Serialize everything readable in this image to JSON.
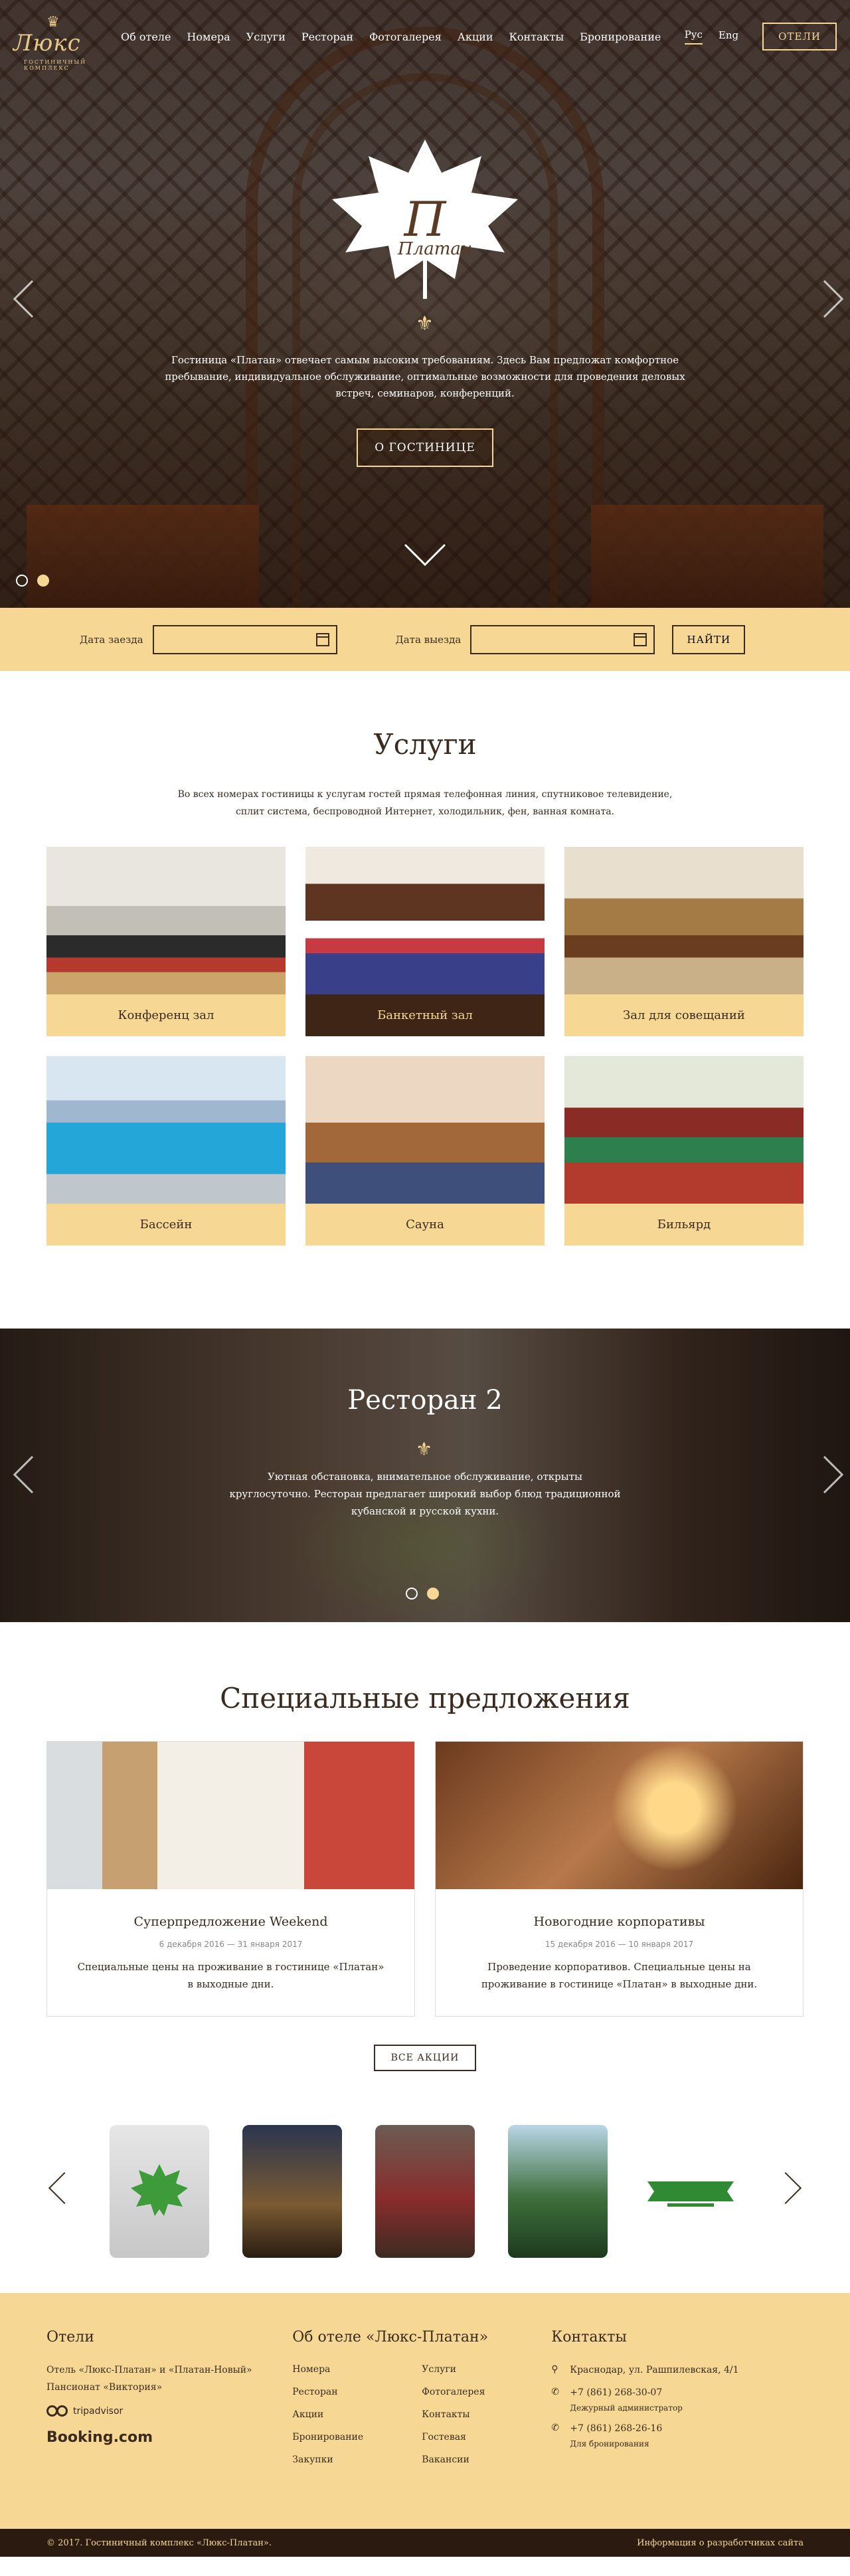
{
  "brand": {
    "logo_text": "Люкс",
    "logo_sub": "ГОСТИНИЧНЫЙ КОМПЛЕКС"
  },
  "nav": [
    "Об отеле",
    "Номера",
    "Услуги",
    "Ресторан",
    "Фотогалерея",
    "Акции",
    "Контакты",
    "Бронирование"
  ],
  "lang": {
    "ru": "Рус",
    "en": "Eng"
  },
  "hotels_button": "ОТЕЛИ",
  "hero": {
    "emblem": "Платан",
    "text": "Гостиница «Платан» отвечает самым высоким требованиям. Здесь Вам предложат комфортное пребывание, индивидуальное обслуживание, оптимальные возможности для проведения деловых встреч, семинаров, конференций.",
    "button": "О ГОСТИНИЦЕ"
  },
  "booking": {
    "checkin": "Дата заезда",
    "checkout": "Дата выезда",
    "find": "НАЙТИ"
  },
  "services": {
    "title": "Услуги",
    "lead": "Во всех номерах гостиницы к услугам гостей прямая телефонная линия, спутниковое телевидение, сплит система, беспроводной Интернет, холодильник, фен, ванная комната.",
    "items": [
      "Конференц зал",
      "Банкетный зал",
      "Зал для совещаний",
      "Бассейн",
      "Сауна",
      "Бильярд"
    ]
  },
  "restaurant": {
    "title": "Ресторан 2",
    "text": "Уютная обстановка, внимательное обслуживание, открыты круглосуточно. Ресторан предлагает широкий выбор блюд традиционной кубанской и русской кухни."
  },
  "special": {
    "title": "Специальные предложения",
    "all": "ВСЕ АКЦИИ",
    "offers": [
      {
        "title": "Суперпредложение Weekend",
        "date": "6 декабря 2016 — 31 января 2017",
        "text": "Специальные цены на проживание в гостинице «Платан» в выходные дни."
      },
      {
        "title": "Новогодние корпоративы",
        "date": "15 декабря 2016 — 10 января 2017",
        "text": "Проведение корпоративов. Специальные цены на проживание в гостинице «Платан» в выходные дни."
      }
    ]
  },
  "footer": {
    "hotels_title": "Отели",
    "hotels_text1": "Отель «Люкс-Платан» и «Платан-Новый»",
    "hotels_text2": "Пансионат «Виктория»",
    "trip": "tripadvisor",
    "bookingcom": "Booking.com",
    "about_title": "Об отеле «Люкс-Платан»",
    "links": [
      "Номера",
      "Услуги",
      "Ресторан",
      "Фотогалерея",
      "Акции",
      "Контакты",
      "Бронирование",
      "Гостевая",
      "Закупки",
      "Вакансии"
    ],
    "contacts_title": "Контакты",
    "address": "Краснодар, ул. Рашпилевская, 4/1",
    "phone1": "+7 (861) 268-30-07",
    "phone1_note": "Дежурный администратор",
    "phone2": "+7 (861) 268-26-16",
    "phone2_note": "Для бронирования",
    "copyright": "© 2017. Гостиничный комплекс «Люкс-Платан».",
    "dev": "Информация о разработчиках сайта"
  }
}
